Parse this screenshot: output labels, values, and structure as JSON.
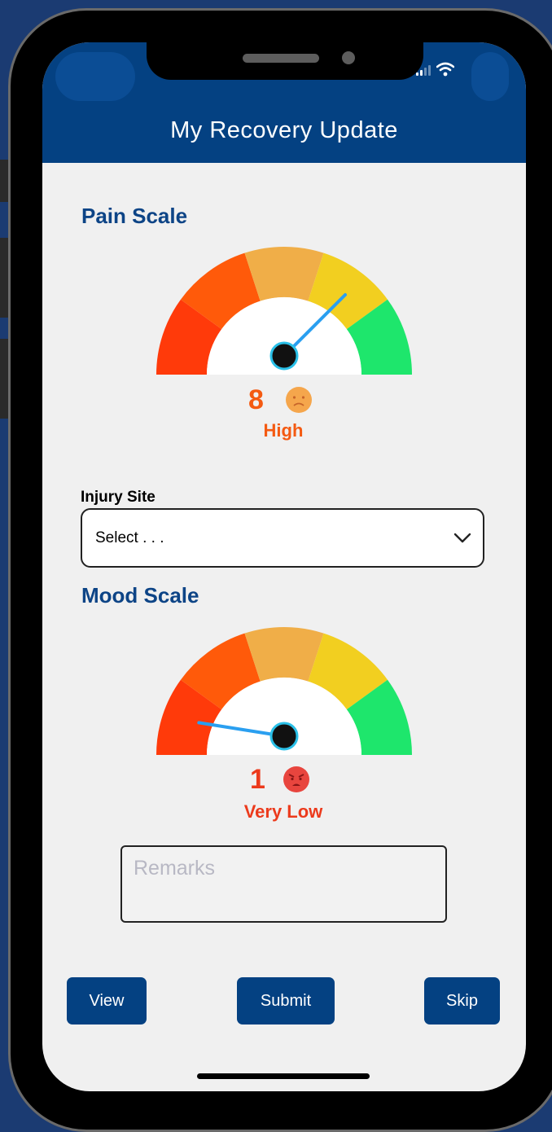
{
  "app": {
    "title": "My Recovery Update"
  },
  "pain": {
    "title": "Pain Scale",
    "value": "8",
    "label": "High",
    "level": 8,
    "scale_max": 10,
    "color": "#f45a12",
    "emoji": "sad-face-icon"
  },
  "injury": {
    "label": "Injury Site",
    "selected": "Select . . ."
  },
  "mood": {
    "title": "Mood Scale",
    "value": "1",
    "label": "Very Low",
    "level": 1,
    "scale_max": 10,
    "color": "#ec3a1c",
    "emoji": "angry-face-icon"
  },
  "remarks": {
    "placeholder": "Remarks"
  },
  "buttons": {
    "view": "View",
    "submit": "Submit",
    "skip": "Skip"
  },
  "colors": {
    "primary": "#044182",
    "gauge_segments": [
      "#ff3a0a",
      "#ff5a0a",
      "#f0ae48",
      "#f2cf20",
      "#1ee66c"
    ]
  }
}
